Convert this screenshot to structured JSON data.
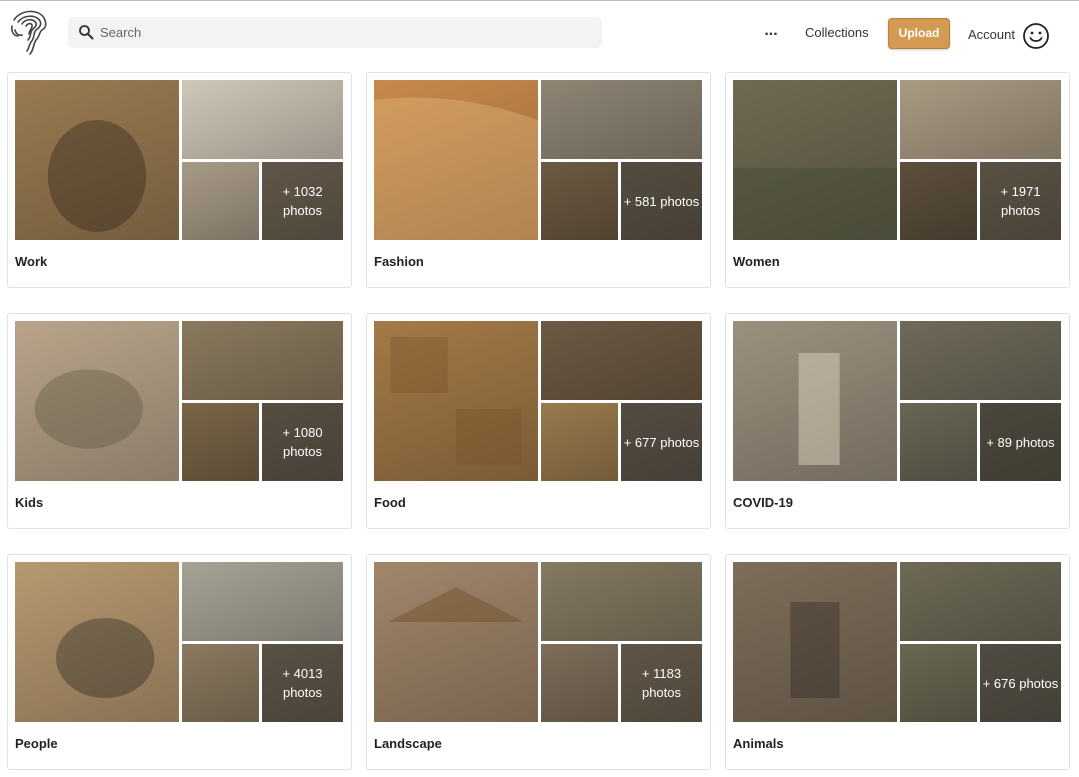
{
  "header": {
    "search_placeholder": "Search",
    "more_label": "...",
    "collections_label": "Collections",
    "upload_label": "Upload",
    "account_label": "Account"
  },
  "colors": {
    "accent": "#d49a52"
  },
  "cards": [
    {
      "title": "Work",
      "count": "+ 1032 photos"
    },
    {
      "title": "Fashion",
      "count": "+ 581 photos"
    },
    {
      "title": "Women",
      "count": "+ 1971 photos"
    },
    {
      "title": "Kids",
      "count": "+ 1080 photos"
    },
    {
      "title": "Food",
      "count": "+ 677 photos"
    },
    {
      "title": "COVID-19",
      "count": "+ 89 photos"
    },
    {
      "title": "People",
      "count": "+ 4013 photos"
    },
    {
      "title": "Landscape",
      "count": "+ 1183 photos"
    },
    {
      "title": "Animals",
      "count": "+ 676 photos"
    }
  ]
}
